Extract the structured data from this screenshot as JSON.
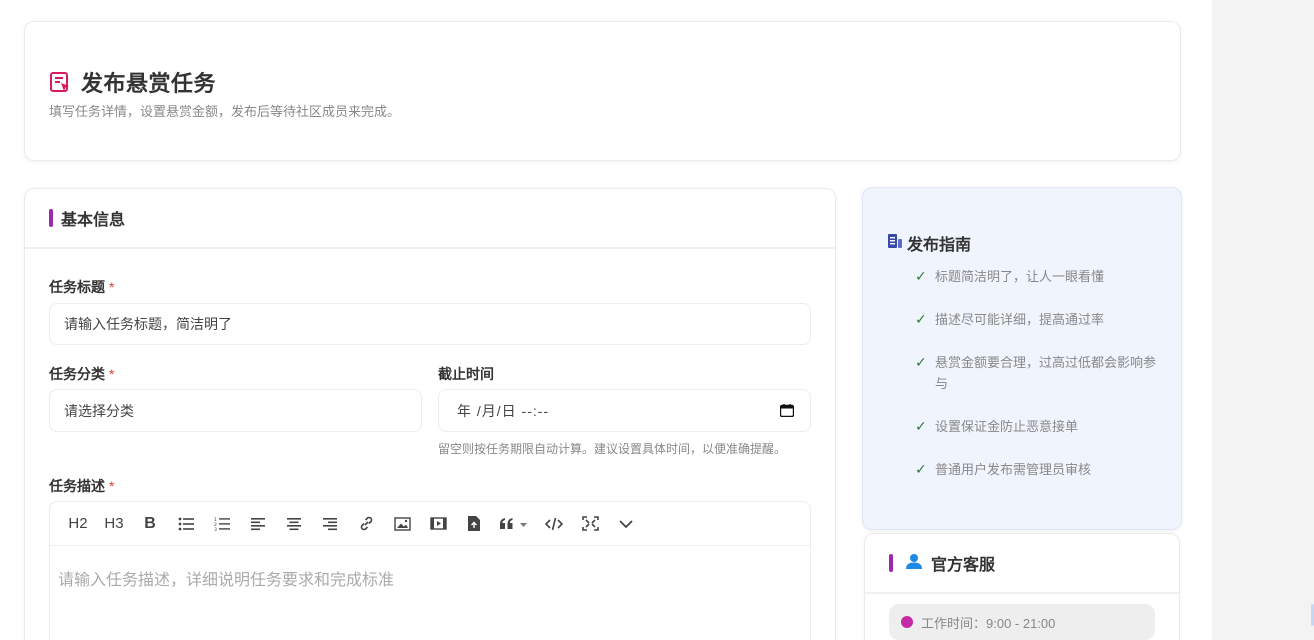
{
  "header": {
    "title": "发布悬赏任务",
    "subtitle": "填写任务详情，设置悬赏金额，发布后等待社区成员来完成。"
  },
  "form": {
    "section_title": "基本信息",
    "title_field": {
      "label": "任务标题",
      "required_mark": "*",
      "placeholder": "请输入任务标题，简洁明了"
    },
    "category_field": {
      "label": "任务分类",
      "required_mark": "*",
      "value": "请选择分类"
    },
    "deadline_field": {
      "label": "截止时间",
      "value": "年 /月/日  --:--",
      "hint": "留空则按任务期限自动计算。建议设置具体时间，以便准确提醒。"
    },
    "description_field": {
      "label": "任务描述",
      "required_mark": "*",
      "placeholder": "请输入任务描述，详细说明任务要求和完成标准"
    },
    "toolbar": {
      "h2": "H2",
      "h3": "H3",
      "bold": "B",
      "icons": [
        "unordered-list-icon",
        "ordered-list-icon",
        "align-left-icon",
        "align-center-icon",
        "align-right-icon",
        "link-icon",
        "image-icon",
        "video-icon",
        "file-upload-icon",
        "quote-icon",
        "code-icon",
        "fullscreen-icon",
        "more-chevron-icon"
      ]
    }
  },
  "guide": {
    "title": "发布指南",
    "items": [
      "标题简洁明了，让人一眼看懂",
      "描述尽可能详细，提高通过率",
      "悬赏金额要合理，过高过低都会影响参与",
      "设置保证金防止恶意接单",
      "普通用户发布需管理员审核"
    ],
    "check_mark": "✓"
  },
  "service": {
    "title": "官方客服",
    "hours": "工作时间：9:00 - 21:00"
  },
  "colors": {
    "accent_purple": "#9c27b0",
    "title_icon_pink": "#d81b60",
    "guide_bg": "#eff4fd",
    "check_green": "#2e7d32",
    "guide_icon_blue": "#3949ab",
    "service_icon_blue": "#1e88e5",
    "hours_dot": "#c52aa6"
  }
}
